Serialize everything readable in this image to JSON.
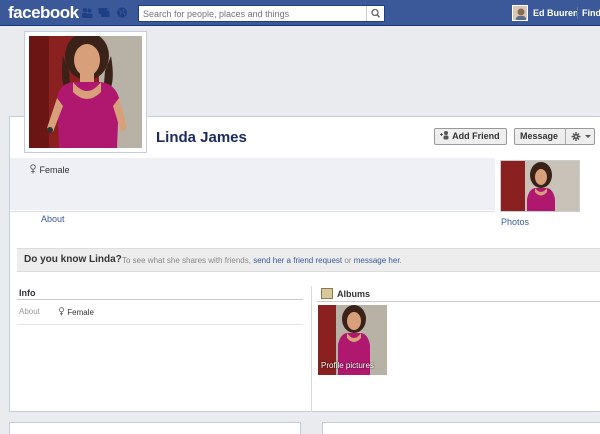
{
  "topbar": {
    "logo": "facebook",
    "search_placeholder": "Search for people, places and things",
    "user_name": "Ed Buuren",
    "find_label": "Find"
  },
  "profile": {
    "name": "Linda James",
    "sex": "Female",
    "add_friend_label": "Add Friend",
    "message_label": "Message",
    "about_link": "About",
    "photos_link": "Photos"
  },
  "know": {
    "title": "Do you know Linda?",
    "text_prefix": "To see what she shares with friends,",
    "request_link": "send her a friend request",
    "text_or": "or",
    "message_link": "message her",
    "text_end": "."
  },
  "info": {
    "title": "Info",
    "about_label": "About",
    "sex_value": "Female"
  },
  "albums": {
    "title": "Albums",
    "album_label": "Profile pictures"
  },
  "colors": {
    "brand": "#3b5998",
    "name_text": "#1d2a5b",
    "background": "#e9ebee"
  }
}
